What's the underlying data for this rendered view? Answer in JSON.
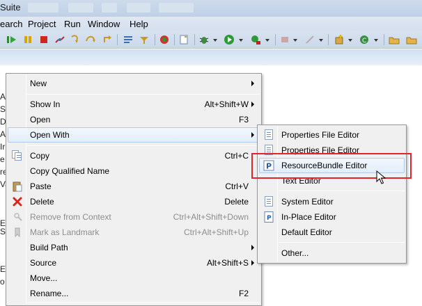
{
  "window": {
    "title_fragment": "Suite"
  },
  "menubar": [
    "earch",
    "Project",
    "Run",
    "Window",
    "Help"
  ],
  "left_edge_fragments": [
    "Ar",
    "S",
    "De",
    "Al",
    "Ir",
    "e",
    "re",
    "Va",
    "E",
    "o",
    "E",
    "S"
  ],
  "context_menu": {
    "items": [
      {
        "label": "New",
        "shortcut": "",
        "submenu": true,
        "icon": "",
        "enabled": true
      },
      {
        "sep": true
      },
      {
        "label": "Show In",
        "shortcut": "Alt+Shift+W",
        "submenu": true,
        "icon": "",
        "enabled": true
      },
      {
        "label": "Open",
        "shortcut": "F3",
        "submenu": false,
        "icon": "",
        "enabled": true
      },
      {
        "label": "Open With",
        "shortcut": "",
        "submenu": true,
        "icon": "",
        "enabled": true,
        "highlighted": true
      },
      {
        "sep": true
      },
      {
        "label": "Copy",
        "shortcut": "Ctrl+C",
        "submenu": false,
        "icon": "copy-icon",
        "enabled": true
      },
      {
        "label": "Copy Qualified Name",
        "shortcut": "",
        "submenu": false,
        "icon": "",
        "enabled": true
      },
      {
        "label": "Paste",
        "shortcut": "Ctrl+V",
        "submenu": false,
        "icon": "paste-icon",
        "enabled": true
      },
      {
        "label": "Delete",
        "shortcut": "Delete",
        "submenu": false,
        "icon": "delete-icon",
        "enabled": true
      },
      {
        "label": "Remove from Context",
        "shortcut": "Ctrl+Alt+Shift+Down",
        "submenu": false,
        "icon": "remove-context-icon",
        "enabled": false
      },
      {
        "label": "Mark as Landmark",
        "shortcut": "Ctrl+Alt+Shift+Up",
        "submenu": false,
        "icon": "landmark-icon",
        "enabled": false
      },
      {
        "label": "Build Path",
        "shortcut": "",
        "submenu": true,
        "icon": "",
        "enabled": true
      },
      {
        "label": "Source",
        "shortcut": "Alt+Shift+S",
        "submenu": true,
        "icon": "",
        "enabled": true
      },
      {
        "label": "Move...",
        "shortcut": "",
        "submenu": false,
        "icon": "",
        "enabled": true
      },
      {
        "label": "Rename...",
        "shortcut": "F2",
        "submenu": false,
        "icon": "",
        "enabled": true
      }
    ]
  },
  "open_with_submenu": {
    "items": [
      {
        "label": "Properties File Editor",
        "icon": "properties-file-icon"
      },
      {
        "label": "Properties File Editor",
        "icon": "properties-file-icon"
      },
      {
        "label": "ResourceBundle Editor",
        "icon": "resourcebundle-icon",
        "highlighted": true
      },
      {
        "label": "Text Editor",
        "icon": ""
      },
      {
        "sep": true
      },
      {
        "label": "System Editor",
        "icon": "system-editor-icon"
      },
      {
        "label": "In-Place Editor",
        "icon": "inplace-editor-icon"
      },
      {
        "label": "Default Editor",
        "icon": ""
      },
      {
        "sep": true
      },
      {
        "label": "Other...",
        "icon": ""
      }
    ]
  },
  "colors": {
    "highlight_box": "#e0262c",
    "menu_bg": "#f0f0f0",
    "toolbar_bg": "#cbd8ea"
  }
}
